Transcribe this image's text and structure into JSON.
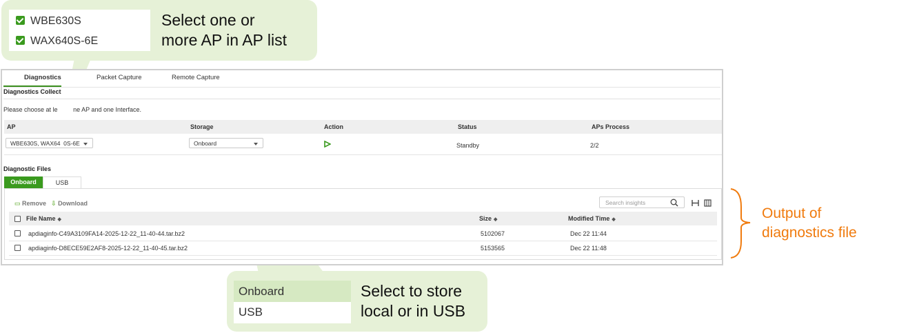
{
  "tabs": [
    "Diagnostics",
    "Packet Capture",
    "Remote Capture"
  ],
  "collection": {
    "title": "Diagnostics Collect",
    "hint": "Please choose at le",
    "hint_tail": "ne AP and one Interface."
  },
  "ap_table": {
    "headers": [
      "AP",
      "Storage",
      "Action",
      "Status",
      "APs Process"
    ],
    "row": {
      "ap": "WBE630S, WAX64",
      "ap_tail": "0S-6E",
      "storage": "Onboard",
      "status": "Standby",
      "process": "2/2"
    }
  },
  "files": {
    "title": "Diagnostic Files",
    "tabs": [
      "Onboard",
      "USB"
    ],
    "remove_label": "Remove",
    "download_label": "Download",
    "search_placeholder": "Search insights",
    "headers": {
      "name": "File Name",
      "size": "Size",
      "time": "Modified Time"
    },
    "rows": [
      {
        "name": "apdiaginfo-C49A3109FA14-2025-12-22_11-40-44.tar.bz2",
        "size": "5102067",
        "time": "Dec 22 11:44"
      },
      {
        "name": "apdiaginfo-D8ECE59E2AF8-2025-12-22_11-40-45.tar.bz2",
        "size": "5153565",
        "time": "Dec 22 11:48"
      }
    ]
  },
  "callouts": {
    "ap_list": {
      "items": [
        "WBE630S",
        "WAX640S-6E"
      ],
      "line1": "Select one or",
      "line2": "more AP in AP list"
    },
    "storage": {
      "options": [
        "Onboard",
        "USB"
      ],
      "line1": "Select to store",
      "line2": "local or in USB"
    },
    "output": {
      "line1": "Output of",
      "line2": "diagnostics file"
    }
  },
  "colors": {
    "accent": "#3a9a1e",
    "callout_bg": "#e6f1d7",
    "orange": "#f07b0e"
  }
}
